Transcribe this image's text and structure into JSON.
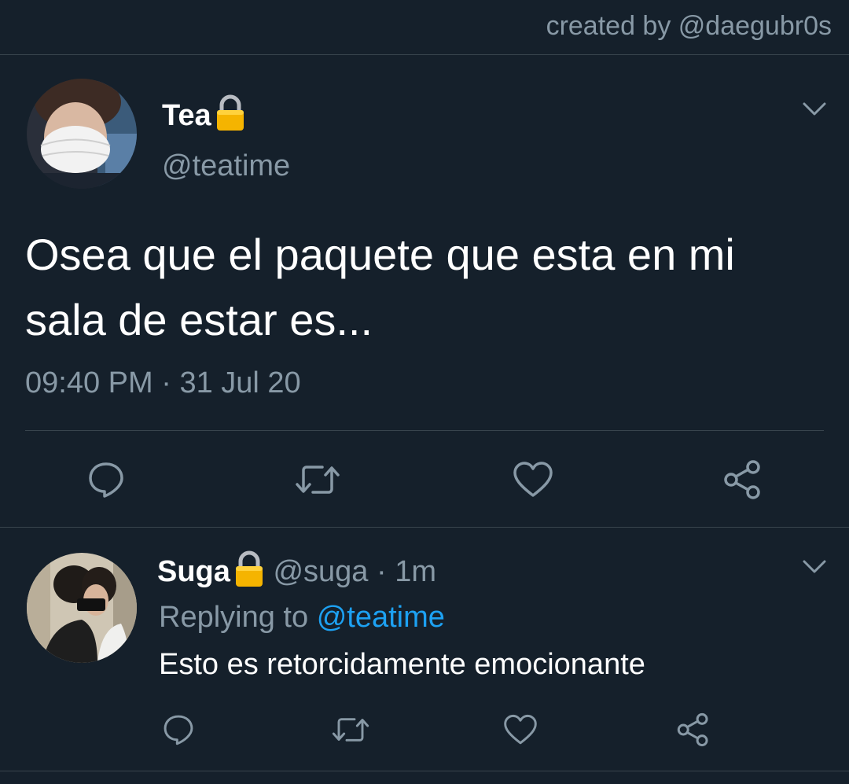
{
  "credit": "created by @daegubr0s",
  "main_tweet": {
    "display_name": "Tea",
    "handle": "@teatime",
    "text_line1": "Osea que el paquete que esta en mi",
    "text_line2": "sala de estar es...",
    "time": "09:40 PM",
    "separator": "·",
    "date": "31 Jul 20",
    "lock_icon": "lock-icon",
    "chevron_icon": "chevron-down-icon"
  },
  "reply": {
    "display_name": "Suga",
    "handle": "@suga",
    "separator": "·",
    "age": "1m",
    "replying_prefix": "Replying to",
    "replying_mention": "@teatime",
    "text": "Esto es retorcidamente emocionante"
  },
  "actions": [
    "reply-icon",
    "retweet-icon",
    "like-icon",
    "share-icon"
  ],
  "colors": {
    "background": "#15202b",
    "text": "#ffffff",
    "muted": "#8899a6",
    "link": "#1da1f2",
    "divider": "#38444d"
  }
}
